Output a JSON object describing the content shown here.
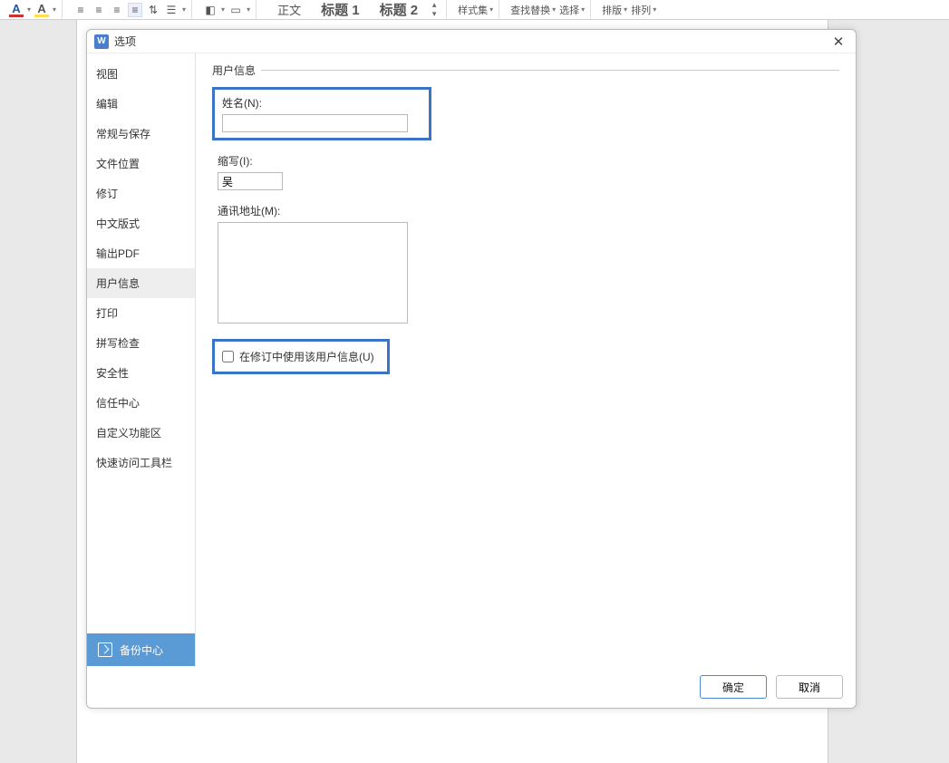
{
  "ribbon": {
    "style_body": "正文",
    "style_heading1": "标题 1",
    "style_heading2": "标题 2",
    "styleset_label": "样式集",
    "findreplace_label": "查找替换",
    "select_label": "选择",
    "arrange_label": "排版",
    "sort_label": "排列"
  },
  "dialog": {
    "title": "选项",
    "sidebar": {
      "items": [
        {
          "label": "视图"
        },
        {
          "label": "编辑"
        },
        {
          "label": "常规与保存"
        },
        {
          "label": "文件位置"
        },
        {
          "label": "修订"
        },
        {
          "label": "中文版式"
        },
        {
          "label": "输出PDF"
        },
        {
          "label": "用户信息"
        },
        {
          "label": "打印"
        },
        {
          "label": "拼写检查"
        },
        {
          "label": "安全性"
        },
        {
          "label": "信任中心"
        },
        {
          "label": "自定义功能区"
        },
        {
          "label": "快速访问工具栏"
        }
      ],
      "selected_index": 7,
      "backup_label": "备份中心"
    },
    "content": {
      "section_title": "用户信息",
      "name_label": "姓名(N):",
      "name_value": "",
      "initials_label": "缩写(I):",
      "initials_value": "吴",
      "address_label": "通讯地址(M):",
      "address_value": "",
      "use_in_track_label": "在修订中使用该用户信息(U)",
      "use_in_track_checked": false
    },
    "footer": {
      "ok": "确定",
      "cancel": "取消"
    }
  }
}
